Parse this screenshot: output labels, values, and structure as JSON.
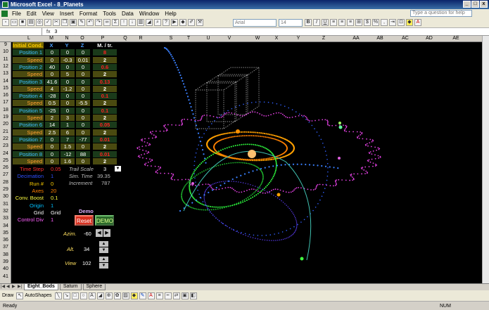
{
  "window": {
    "title": "Microsoft Excel - 8_Planets",
    "min": "_",
    "max": "□",
    "close": "x"
  },
  "menu": [
    "File",
    "Edit",
    "View",
    "Insert",
    "Format",
    "Tools",
    "Data",
    "Window",
    "Help"
  ],
  "help_box": "Type a question for help",
  "toolbar": {
    "font": "Arial",
    "size": "14"
  },
  "formula": {
    "fx": "fx",
    "value": "3"
  },
  "columns": [
    "L",
    "M",
    "N",
    "O",
    "P",
    "Q",
    "R",
    "S",
    "T",
    "U",
    "V",
    "W",
    "X",
    "Y",
    "Z",
    "AA",
    "AB",
    "AC",
    "AD",
    "AE"
  ],
  "rows": [
    "9",
    "10",
    "11",
    "12",
    "13",
    "14",
    "15",
    "16",
    "17",
    "18",
    "19",
    "20",
    "21",
    "22",
    "23",
    "24",
    "25",
    "26",
    "27",
    "28",
    "29",
    "30",
    "31",
    "32",
    "33",
    "34",
    "35",
    "36",
    "37",
    "38",
    "39",
    "40",
    "41"
  ],
  "table": {
    "headers": [
      "Initial Cond.",
      "X",
      "Y",
      "Z",
      "M. / tr."
    ],
    "rows": [
      {
        "label": "Position 1",
        "x": "0",
        "y": "0",
        "z": "0",
        "m": "8",
        "kind": "pos",
        "mcolor": "#ff2020"
      },
      {
        "label": "Speed",
        "x": "0",
        "y": "-0.3",
        "z": "0.01",
        "m": "2",
        "kind": "spd",
        "mcolor": "#ffffff"
      },
      {
        "label": "Position 2",
        "x": "40",
        "y": "0",
        "z": "0",
        "m": "0.6",
        "kind": "pos",
        "mcolor": "#ff2020"
      },
      {
        "label": "Speed",
        "x": "0",
        "y": "5",
        "z": "0",
        "m": "2",
        "kind": "spd",
        "mcolor": "#ffffff"
      },
      {
        "label": "Position 3",
        "x": "41.6",
        "y": "0",
        "z": "0",
        "m": "0.13",
        "kind": "pos",
        "mcolor": "#ff2020"
      },
      {
        "label": "Speed",
        "x": "4",
        "y": "-1.2",
        "z": "0",
        "m": "2",
        "kind": "spd",
        "mcolor": "#ffffff"
      },
      {
        "label": "Position 4",
        "x": "-28",
        "y": "0",
        "z": "0",
        "m": "0.1",
        "kind": "pos",
        "mcolor": "#ff2020"
      },
      {
        "label": "Speed",
        "x": "0.5",
        "y": "0",
        "z": "-5.5",
        "m": "2",
        "kind": "spd",
        "mcolor": "#ffffff"
      },
      {
        "label": "Position 5",
        "x": "-25",
        "y": "0",
        "z": "0",
        "m": "0.1",
        "kind": "pos",
        "mcolor": "#ff2020"
      },
      {
        "label": "Speed",
        "x": "2",
        "y": "3",
        "z": "0",
        "m": "2",
        "kind": "spd",
        "mcolor": "#ffffff"
      },
      {
        "label": "Position 6",
        "x": "14",
        "y": "1",
        "z": "0",
        "m": "0.05",
        "kind": "pos",
        "mcolor": "#ff2020"
      },
      {
        "label": "Speed",
        "x": "2.5",
        "y": "6",
        "z": "0",
        "m": "2",
        "kind": "spd",
        "mcolor": "#ffffff"
      },
      {
        "label": "Position 7",
        "x": "0",
        "y": "7",
        "z": "-77",
        "m": "0.01",
        "kind": "pos",
        "mcolor": "#ff2020"
      },
      {
        "label": "Speed",
        "x": "0",
        "y": "1.5",
        "z": "0",
        "m": "2",
        "kind": "spd",
        "mcolor": "#ffffff"
      },
      {
        "label": "Position 8",
        "x": "0",
        "y": "-12",
        "z": "88",
        "m": "0.01",
        "kind": "pos",
        "mcolor": "#ff2020"
      },
      {
        "label": "Speed",
        "x": "0",
        "y": "1.6",
        "z": "0",
        "m": "2",
        "kind": "spd",
        "mcolor": "#ffffff"
      }
    ]
  },
  "params": [
    {
      "label": "Time Step",
      "value": "0.05",
      "color": "#ff3030"
    },
    {
      "label": "Decimation",
      "value": "1",
      "color": "#3050ff"
    },
    {
      "label": "Run #",
      "value": "0",
      "color": "#ffd000"
    },
    {
      "label": "Axes",
      "value": "20",
      "color": "#ff8000"
    },
    {
      "label": "Conv. Boost",
      "value": "0.1",
      "color": "#ffff40"
    },
    {
      "label": "Origin",
      "value": "1",
      "color": "#00c0ff"
    },
    {
      "label": "Grid",
      "value": "Grid",
      "color": "#ffffff"
    },
    {
      "label": "Control Div",
      "value": "1",
      "color": "#ff60ff"
    }
  ],
  "sim": {
    "trail_label": "Trail Scale",
    "trail_value": "3",
    "simtime_label": "Sim. Time",
    "simtime_value": "39.35",
    "incr_label": "Increment",
    "incr_value": "787"
  },
  "demo": {
    "title": "Demo",
    "reset": "Reset",
    "demo": "DEMO"
  },
  "view": {
    "azim_label": "Azim.",
    "azim": "-60",
    "alt_label": "Alt.",
    "alt": "34",
    "view_label": "View",
    "view": "102"
  },
  "tabs": [
    "Eight_Bods",
    "Saturn",
    "Sphere"
  ],
  "drawbar": {
    "draw": "Draw",
    "autoshapes": "AutoShapes"
  },
  "status": {
    "ready": "Ready",
    "num": "NUM"
  }
}
